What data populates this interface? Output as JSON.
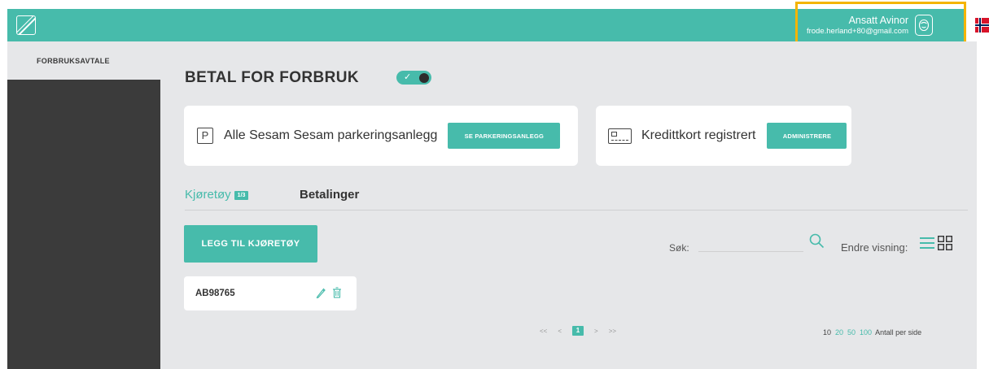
{
  "header": {
    "user_name": "Ansatt Avinor",
    "user_email": "frode.herland+80@gmail.com",
    "accent_color": "#47bbab",
    "highlight_color": "#f4b400"
  },
  "sidebar": {
    "items": [
      {
        "label": "FORBRUKSAVTALE"
      }
    ]
  },
  "main": {
    "title": "BETAL FOR FORBRUK",
    "toggle_on": true,
    "parking_card": {
      "text": "Alle Sesam Sesam parkeringsanlegg",
      "button": "SE PARKERINGSANLEGG",
      "icon": "parking-icon"
    },
    "card_card": {
      "text": "Kredittkort registrert",
      "button": "ADMINISTRERE",
      "icon": "credit-card-icon"
    },
    "tabs": {
      "vehicles": "Kjøretøy",
      "vehicles_badge": "1/3",
      "payments": "Betalinger"
    },
    "add_vehicle_button": "LEGG TIL KJØRETØY",
    "search": {
      "label": "Søk:",
      "value": "",
      "placeholder": ""
    },
    "view_label": "Endre visning:",
    "vehicles": [
      {
        "plate": "AB98765"
      }
    ],
    "pagination": {
      "first": "<<",
      "prev": "<",
      "current": "1",
      "next": ">",
      "last": ">>"
    },
    "per_page": {
      "options": [
        "10",
        "20",
        "50",
        "100"
      ],
      "label": "Antall per side"
    }
  }
}
